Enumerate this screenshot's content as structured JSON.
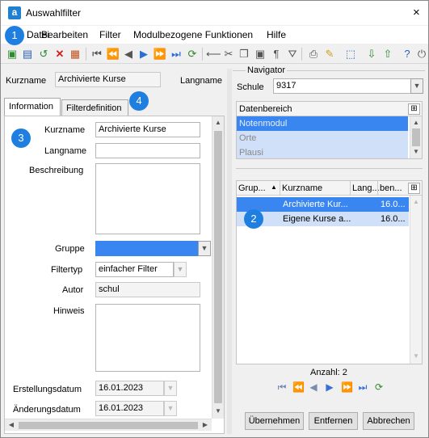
{
  "window": {
    "title": "Auswahlfilter",
    "close_glyph": "×"
  },
  "menu": [
    "Datei",
    "Bearbeiten",
    "Filter",
    "Modulbezogene Funktionen",
    "Hilfe"
  ],
  "header": {
    "kurzname_label": "Kurzname",
    "kurzname_value": "Archivierte Kurse",
    "langname_label": "Langname"
  },
  "tabs": [
    "Information",
    "Filterdefinition"
  ],
  "form": {
    "kurzname_label": "Kurzname",
    "kurzname_value": "Archivierte Kurse",
    "langname_label": "Langname",
    "langname_value": "",
    "beschreibung_label": "Beschreibung",
    "beschreibung_value": "",
    "gruppe_label": "Gruppe",
    "gruppe_value": "",
    "filtertyp_label": "Filtertyp",
    "filtertyp_value": "einfacher Filter",
    "autor_label": "Autor",
    "autor_value": "schul",
    "hinweis_label": "Hinweis",
    "hinweis_value": "",
    "erstellungsdatum_label": "Erstellungsdatum",
    "erstellungsdatum_value": "16.01.2023",
    "aenderungsdatum_label": "Änderungsdatum",
    "aenderungsdatum_value": "16.01.2023"
  },
  "navigator": {
    "title": "Navigator",
    "schule_label": "Schule",
    "schule_value": "9317",
    "datenbereich_header": "Datenbereich",
    "datenbereich_items": [
      "Notenmodul",
      "Orte",
      "Plausi"
    ],
    "grid_columns": [
      "Grup...",
      "Kurzname",
      "Lang...",
      "ben..."
    ],
    "grid_rows": [
      {
        "gruppe": "",
        "kurzname": "Archivierte Kur...",
        "langname": "",
        "ben": "16.0..."
      },
      {
        "gruppe": "",
        "kurzname": "Eigene Kurse a...",
        "langname": "",
        "ben": "16.0..."
      }
    ],
    "anzahl": "Anzahl: 2"
  },
  "buttons": {
    "uebernehmen": "Übernehmen",
    "entfernen": "Entfernen",
    "abbrechen": "Abbrechen"
  },
  "badges": [
    "1",
    "2",
    "3",
    "4"
  ],
  "colors": {
    "accent": "#1e7fe0",
    "selection": "#3a86f0",
    "selection_light": "#cfe0f8"
  }
}
